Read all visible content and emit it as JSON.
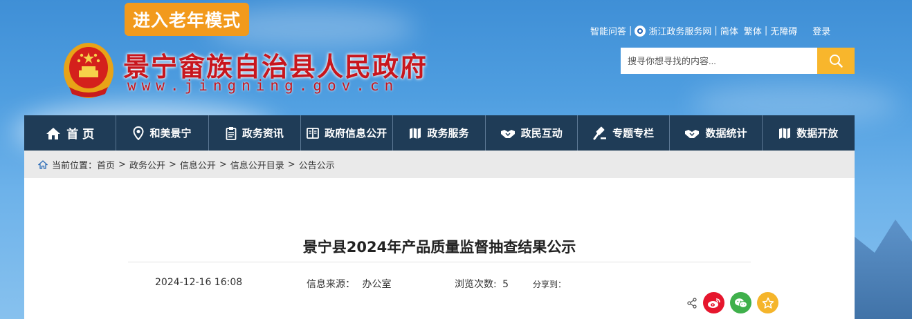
{
  "header": {
    "elder_mode_label": "进入老年模式",
    "site_title": "景宁畲族自治县人民政府",
    "site_url": "www.jingning.gov.cn",
    "top_links": {
      "qa": "智能问答",
      "zj_portal": "浙江政务服务网",
      "simplified": "简体",
      "traditional": "繁体",
      "accessibility": "无障碍",
      "login": "登录"
    },
    "search": {
      "placeholder": "搜寻你想寻找的内容..."
    }
  },
  "nav": {
    "items": [
      {
        "label": "首 页",
        "icon": "home-icon"
      },
      {
        "label": "和美景宁",
        "icon": "location-pin-icon"
      },
      {
        "label": "政务资讯",
        "icon": "clipboard-icon"
      },
      {
        "label": "政府信息公开",
        "icon": "open-book-icon"
      },
      {
        "label": "政务服务",
        "icon": "map-icon"
      },
      {
        "label": "政民互动",
        "icon": "handshake-icon"
      },
      {
        "label": "专题专栏",
        "icon": "gavel-icon"
      },
      {
        "label": "数据统计",
        "icon": "handshake-data-icon"
      },
      {
        "label": "数据开放",
        "icon": "map-open-icon"
      }
    ]
  },
  "breadcrumb": {
    "prefix": "当前位置：",
    "items": [
      "首页",
      "政务公开",
      "信息公开",
      "信息公开目录",
      "公告公示"
    ]
  },
  "article": {
    "title": "景宁县2024年产品质量监督抽查结果公示",
    "datetime": "2024-12-16 16:08",
    "source_label": "信息来源：",
    "source_value": "办公室",
    "views_label": "浏览次数:",
    "views_value": "5",
    "share_label": "分享到："
  },
  "colors": {
    "nav_bg": "#1f3c57",
    "accent_orange": "#f29a1c",
    "search_btn": "#f8b62c",
    "title_red": "#c8161d",
    "weibo_red": "#e6162d",
    "wechat_green": "#3fb04b",
    "favorite_yellow": "#f5b52b"
  }
}
